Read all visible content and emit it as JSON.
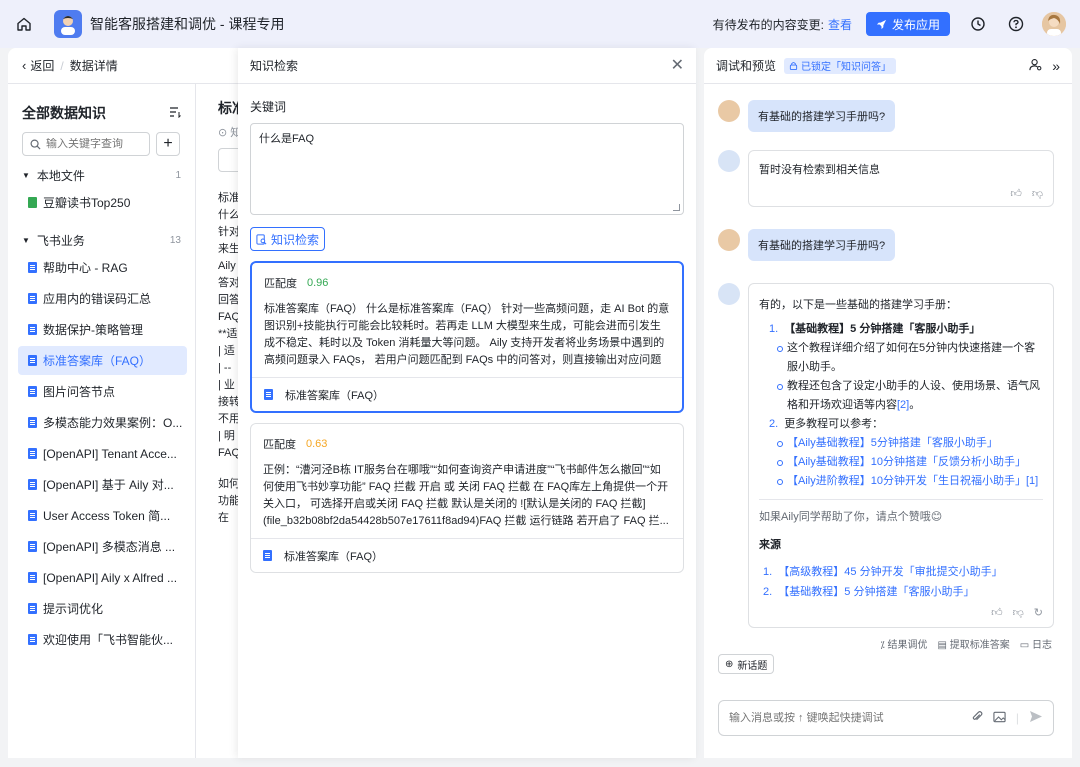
{
  "topbar": {
    "title": "智能客服搭建和调优 - 课程专用",
    "pending_text": "有待发布的内容变更:",
    "pending_link": "查看",
    "publish_label": "发布应用"
  },
  "breadcrumb": {
    "back": "返回",
    "current": "数据详情"
  },
  "sidebar": {
    "title": "全部数据知识",
    "search_placeholder": "输入关键字查询",
    "groups": [
      {
        "label": "本地文件",
        "count": "1",
        "items": [
          "豆瓣读书Top250"
        ]
      },
      {
        "label": "飞书业务",
        "count": "13",
        "items": [
          "帮助中心 - RAG",
          "应用内的错误码汇总",
          "数据保护-策略管理",
          "标准答案库（FAQ）",
          "图片问答节点",
          "多模态能力效果案例：O...",
          "[OpenAPI] Tenant Acce...",
          "[OpenAPI] 基于 Aily 对...",
          "User Access Token 简...",
          "[OpenAPI] 多模态消息 ...",
          "[OpenAPI] Aily x Alfred ...",
          "提示词优化",
          "欢迎使用「飞书智能伙..."
        ]
      }
    ]
  },
  "middle": {
    "title": "标准答",
    "subtitle": "知识",
    "text_lines": [
      "标准",
      "什么",
      "针对",
      "来生",
      "Aily",
      "答对",
      "回答",
      "FAQ",
      "**适",
      "| 适",
      "| --",
      "| 业",
      "接转",
      "不用",
      "| 明",
      "FAQ"
    ],
    "tail_lines": [
      "如何",
      "功能",
      "在"
    ]
  },
  "knowledge_search": {
    "title": "知识检索",
    "keyword_label": "关键词",
    "keyword_value": "什么是FAQ",
    "search_button": "知识检索",
    "score_label": "匹配度",
    "results": [
      {
        "score": "0.96",
        "text": "标准答案库（FAQ） 什么是标准答案库（FAQ） 针对一些高频问题，走 AI Bot 的意图识别+技能执行可能会比较耗时。若再走 LLM 大模型来生成，可能会进而引发生成不稳定、耗时以及 Token 消耗量大等问题。 Aily 支持开发者将业务场景中遇到的高频问题录入 FAQs， 若用户问题匹配到 FAQs 中的问答对，则直接输出对应问题的答案，...",
        "source": "标准答案库（FAQ）"
      },
      {
        "score": "0.63",
        "text": "正例：“漕河泾B栋 IT服务台在哪哦”“如何查询资产申请进度”“飞书邮件怎么撤回”“如何使用飞书妙享功能” FAQ 拦截 开启 或 关闭 FAQ 拦截 在 FAQ库左上角提供一个开关入口， 可选择开启或关闭 FAQ 拦截 默认是关闭的 ![默认是关闭的 FAQ 拦截](file_b32b08bf2da54428b507e17611f8ad94)FAQ 拦截 运行链路 若开启了 FAQ 拦...",
        "source": "标准答案库（FAQ）"
      }
    ]
  },
  "preview": {
    "title": "调试和预览",
    "lock_tag": "已锁定「知识问答」",
    "messages": {
      "user_q1": "有基础的搭建学习手册吗?",
      "bot_a1": "暂时没有检索到相关信息",
      "user_q2": "有基础的搭建学习手册吗?",
      "bot_intro": "有的，以下是一些基础的搭建学习手册：",
      "item1_title": "【基础教程】5 分钟搭建「客服小助手」",
      "item1_b1": "这个教程详细介绍了如何在5分钟内快速搭建一个客服小助手。",
      "item1_b2_pre": "教程还包含了设定小助手的人设、使用场景、语气风格和开场欢迎语等内容",
      "item1_b2_ref": "[2]",
      "item1_b2_end": "。",
      "item2_title": "更多教程可以参考：",
      "item2_l1": "【Aily基础教程】5分钟搭建「客服小助手」",
      "item2_l2": "【Aily基础教程】10分钟搭建「反馈分析小助手」",
      "item2_l3": "【Aily进阶教程】10分钟开发「生日祝福小助手」[1]",
      "closing": "如果Aily同学帮助了你，请点个赞哦😊",
      "source_title": "来源",
      "source1": "【高级教程】45 分钟开发「审批提交小助手」",
      "source2": "【基础教程】5 分钟搭建「客服小助手」"
    },
    "tools": [
      "结果调优",
      "提取标准答案",
      "日志"
    ],
    "new_topic": "新话题",
    "input_placeholder": "输入消息或按 ↑ 键唤起快捷调试"
  }
}
